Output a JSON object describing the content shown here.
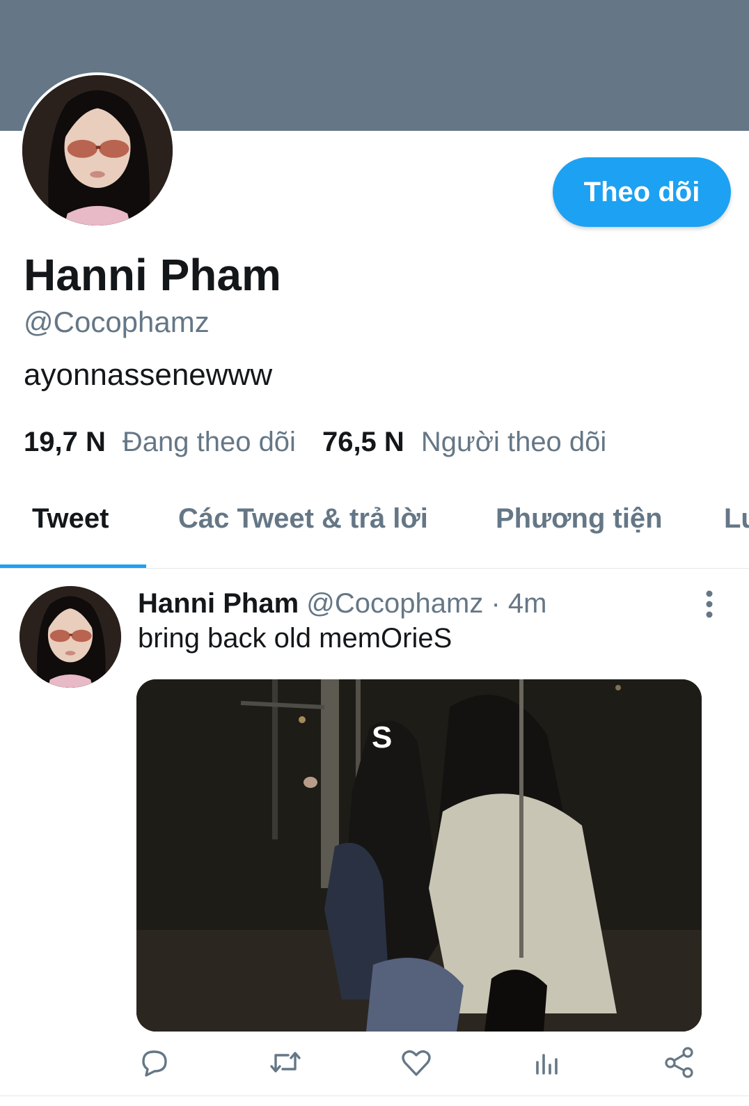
{
  "profile": {
    "display_name": "Hanni Pham",
    "handle": "@Cocophamz",
    "bio": "ayonnassenewww",
    "follow_button_label": "Theo dõi",
    "stats": {
      "following_count": "19,7 N",
      "following_label": "Đang theo dõi",
      "followers_count": "76,5 N",
      "followers_label": "Người theo dõi"
    }
  },
  "tabs": [
    {
      "label": "Tweet",
      "active": true
    },
    {
      "label": "Các Tweet & trả lời",
      "active": false
    },
    {
      "label": "Phương tiện",
      "active": false
    },
    {
      "label": "Lu",
      "active": false
    }
  ],
  "tweet": {
    "author_name": "Hanni Pham",
    "author_handle": "@Cocophamz",
    "separator": " · ",
    "time": "4m",
    "text": "bring back old memOrieS",
    "media_overlay_letter": "S",
    "actions": [
      "reply-icon",
      "retweet-icon",
      "like-icon",
      "analytics-icon",
      "share-icon"
    ]
  },
  "colors": {
    "banner": "#657786",
    "accent": "#1da1f2",
    "text_primary": "#14171a",
    "text_secondary": "#657786"
  }
}
